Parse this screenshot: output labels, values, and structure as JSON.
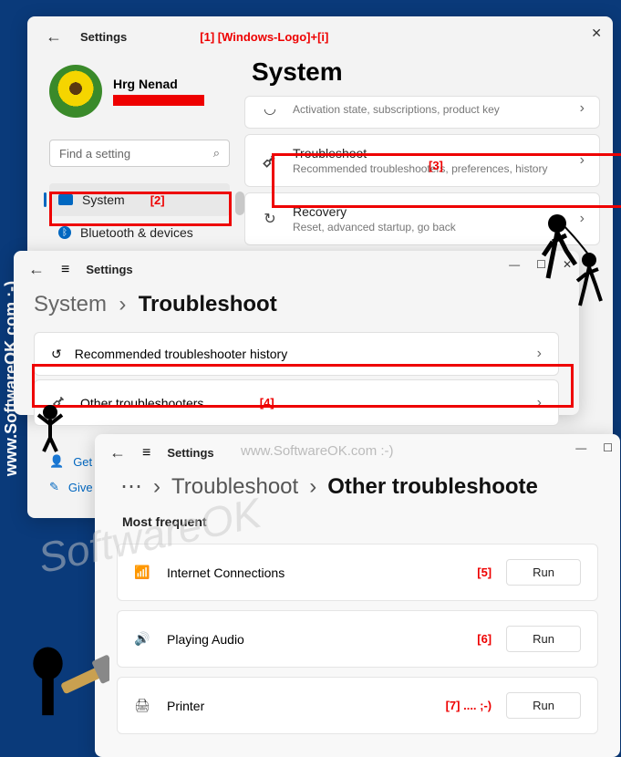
{
  "watermark_vertical": "www.SoftwareOK.com :-)",
  "watermark_inline": "www.SoftwareOK.com :-)",
  "watermark_big": "SoftwareOK",
  "anno": {
    "a1": "[1]   [Windows-Logo]+[i]",
    "a2": "[2]",
    "a3": "[3]",
    "a4": "[4]",
    "a5": "[5]",
    "a6": "[6]",
    "a7": "[7] .... ;-)"
  },
  "win1": {
    "settings": "Settings",
    "profile_name": "Hrg Nenad",
    "search_placeholder": "Find a setting",
    "nav": {
      "system": "System",
      "bluetooth": "Bluetooth & devices"
    },
    "title": "System",
    "cards": {
      "activation_sub": "Activation state, subscriptions, product key",
      "troubleshoot_title": "Troubleshoot",
      "troubleshoot_sub": "Recommended troubleshooters, preferences, history",
      "recovery_title": "Recovery",
      "recovery_sub": "Reset, advanced startup, go back"
    },
    "footer": {
      "get_help": "Get h",
      "give_feedback": "Give f"
    }
  },
  "win2": {
    "settings": "Settings",
    "bc_system": "System",
    "bc_current": "Troubleshoot",
    "row_history": "Recommended troubleshooter history",
    "row_other": "Other troubleshooters"
  },
  "win3": {
    "settings": "Settings",
    "bc_troubleshoot": "Troubleshoot",
    "bc_current": "Other troubleshoote",
    "section": "Most frequent",
    "items": {
      "internet": "Internet Connections",
      "audio": "Playing Audio",
      "printer": "Printer"
    },
    "run": "Run"
  }
}
